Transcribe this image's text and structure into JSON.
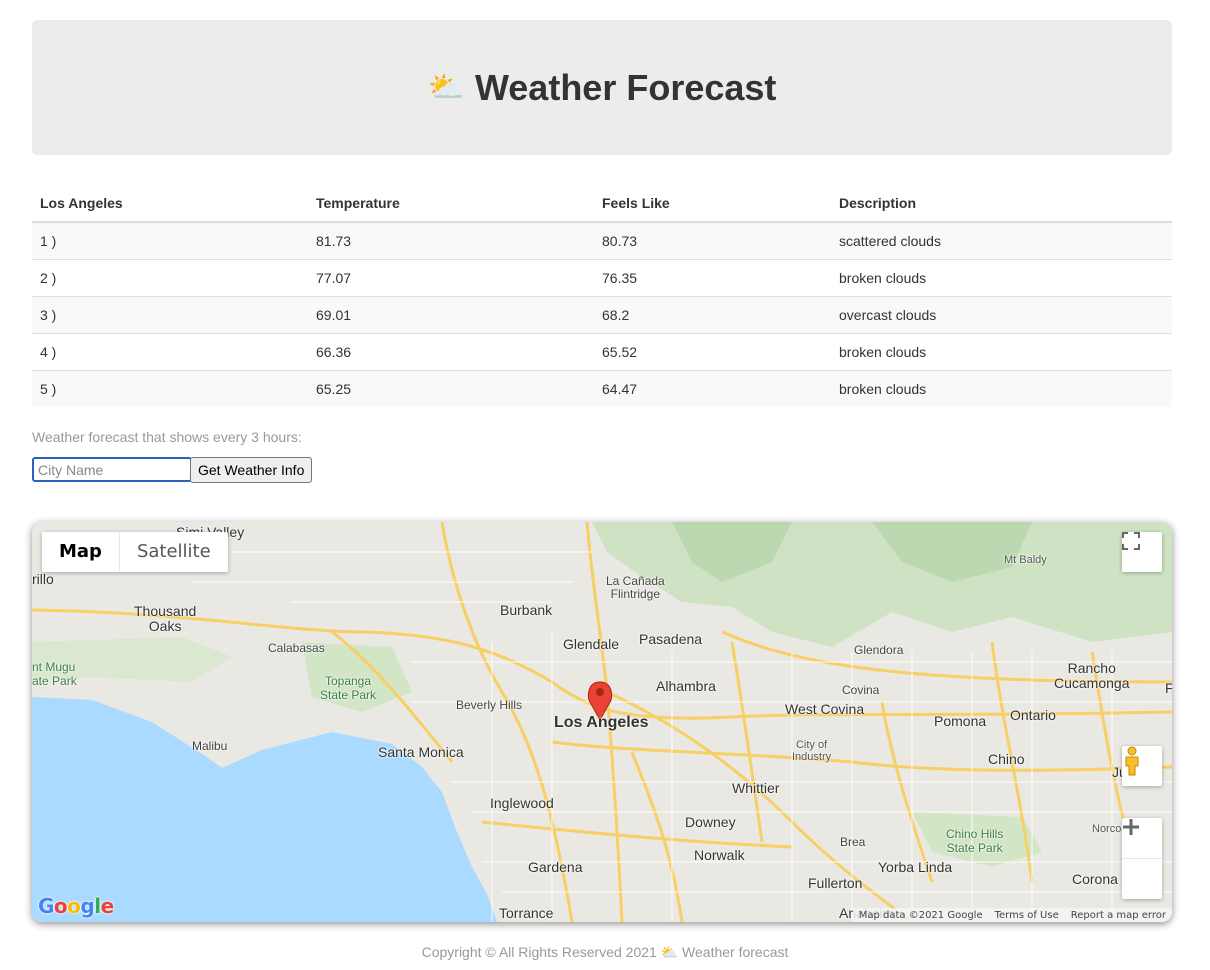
{
  "header": {
    "icon": "sun-behind-cloud-icon",
    "title": "Weather Forecast"
  },
  "table": {
    "headers": [
      "Los Angeles",
      "Temperature",
      "Feels Like",
      "Description"
    ],
    "rows": [
      [
        "1 )",
        "81.73",
        "80.73",
        "scattered clouds"
      ],
      [
        "2 )",
        "77.07",
        "76.35",
        "broken clouds"
      ],
      [
        "3 )",
        "69.01",
        "68.2",
        "overcast clouds"
      ],
      [
        "4 )",
        "66.36",
        "65.52",
        "broken clouds"
      ],
      [
        "5 )",
        "65.25",
        "64.47",
        "broken clouds"
      ]
    ]
  },
  "form": {
    "hint": "Weather forecast that shows every 3 hours:",
    "placeholder": "City Name",
    "button_label": "Get Weather Info"
  },
  "map": {
    "type_buttons": {
      "map": "Map",
      "satellite": "Satellite"
    },
    "attribution": {
      "data": "Map data ©2021 Google",
      "terms": "Terms of Use",
      "report": "Report a map error"
    },
    "logo": "Google",
    "places": {
      "simi_valley": "Simi Valley",
      "thousand_oaks": "Thousand\nOaks",
      "calabasas": "Calabasas",
      "topanga": "Topanga\nState Park",
      "mugu": "nt Mugu\nate Park",
      "rillo": "rillo",
      "malibu": "Malibu",
      "santa_monica": "Santa Monica",
      "beverly_hills": "Beverly Hills",
      "burbank": "Burbank",
      "glendale": "Glendale",
      "pasadena": "Pasadena",
      "la_canada": "La Cañada\nFlintridge",
      "alhambra": "Alhambra",
      "los_angeles": "Los Angeles",
      "west_covina": "West Covina",
      "covina": "Covina",
      "glendora": "Glendora",
      "mt_baldy": "Mt Baldy",
      "rancho": "Rancho\nCucamonga",
      "ontario": "Ontario",
      "pomona": "Pomona",
      "chino": "Chino",
      "chino_hills": "Chino Hills\nState Park",
      "city_industry": "City of\nIndustry",
      "whittier": "Whittier",
      "inglewood": "Inglewood",
      "downey": "Downey",
      "norwalk": "Norwalk",
      "gardena": "Gardena",
      "torrance": "Torrance",
      "brea": "Brea",
      "yorba_linda": "Yorba Linda",
      "fullerton": "Fullerton",
      "anaheim": "Anaheim",
      "corona": "Corona",
      "norco": "Norco",
      "jurupa": "Ju Va",
      "f_edge": "F"
    }
  },
  "footer": {
    "prefix": "Copyright © All Rights Reserved 2021",
    "suffix": "Weather forecast"
  }
}
